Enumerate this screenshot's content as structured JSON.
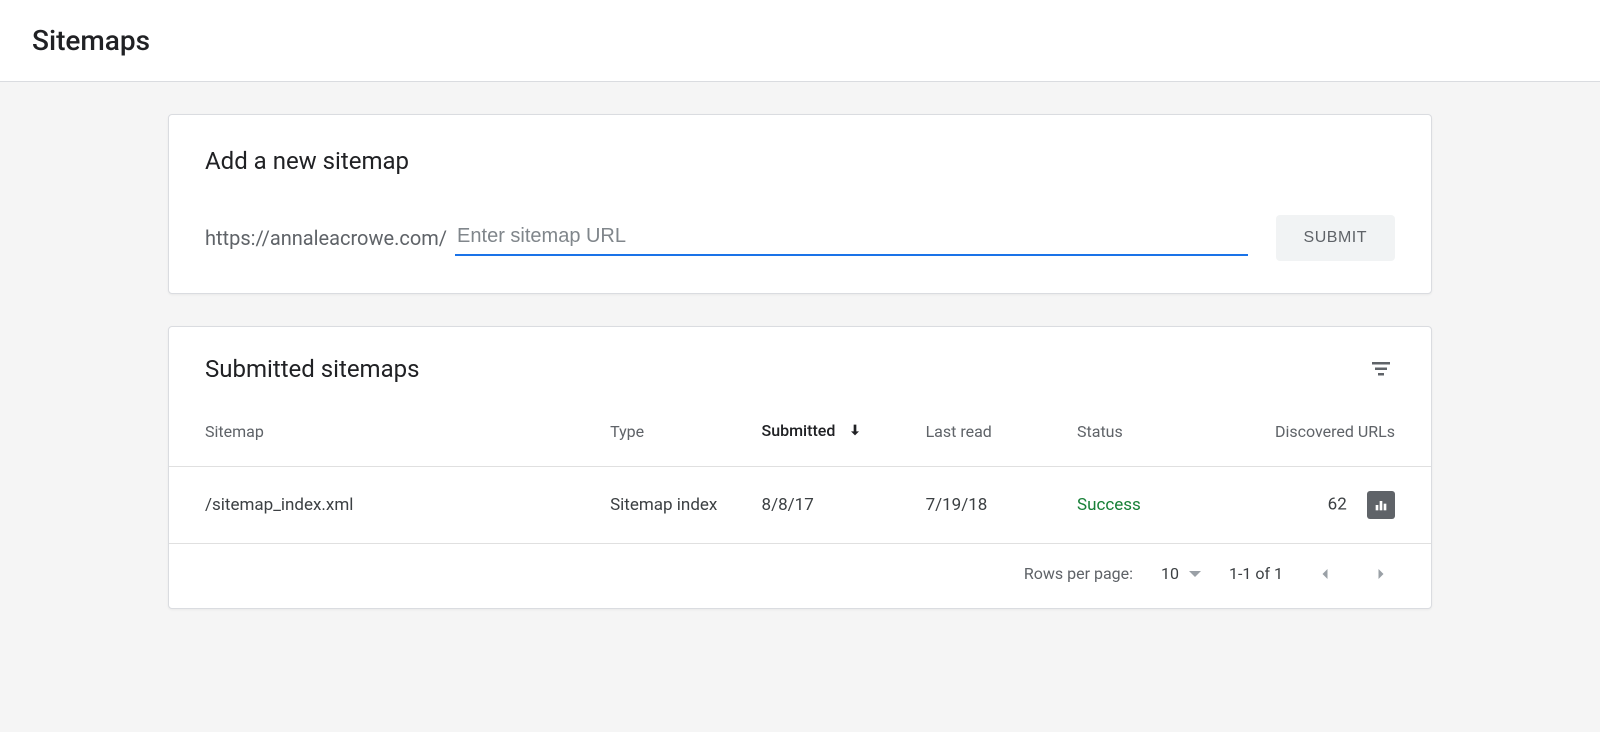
{
  "page": {
    "title": "Sitemaps"
  },
  "add_card": {
    "title": "Add a new sitemap",
    "url_prefix": "https://annaleacrowe.com/",
    "input_placeholder": "Enter sitemap URL",
    "input_value": "",
    "submit_label": "SUBMIT"
  },
  "list_card": {
    "title": "Submitted sitemaps",
    "columns": {
      "sitemap": "Sitemap",
      "type": "Type",
      "submitted": "Submitted",
      "last_read": "Last read",
      "status": "Status",
      "discovered": "Discovered URLs"
    },
    "sorted_column": "submitted",
    "sort_direction": "desc",
    "rows": [
      {
        "sitemap": "/sitemap_index.xml",
        "type": "Sitemap index",
        "submitted": "8/8/17",
        "last_read": "7/19/18",
        "status": "Success",
        "discovered": "62"
      }
    ],
    "pagination": {
      "rows_label": "Rows per page:",
      "rows_value": "10",
      "range": "1-1 of 1"
    }
  }
}
